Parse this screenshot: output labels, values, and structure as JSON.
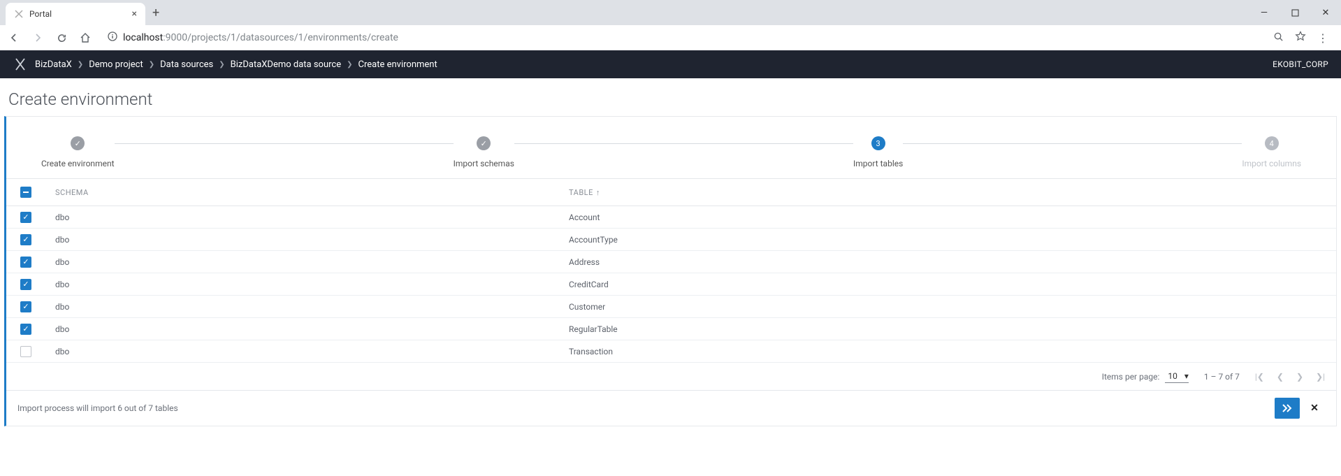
{
  "browser": {
    "tab_title": "Portal",
    "url_host": "localhost",
    "url_port_path": ":9000/projects/1/datasources/1/environments/create"
  },
  "header": {
    "brand": "BizDataX",
    "crumbs": [
      "Demo project",
      "Data sources",
      "BizDataXDemo data source",
      "Create environment"
    ],
    "user": "EKOBIT_CORP"
  },
  "page": {
    "title": "Create environment"
  },
  "stepper": {
    "steps": [
      {
        "label": "Create environment",
        "state": "done"
      },
      {
        "label": "Import schemas",
        "state": "done"
      },
      {
        "label": "Import tables",
        "state": "active",
        "num": "3"
      },
      {
        "label": "Import columns",
        "state": "next",
        "num": "4"
      }
    ]
  },
  "table": {
    "columns": {
      "schema": "SCHEMA",
      "table": "TABLE"
    },
    "rows": [
      {
        "schema": "dbo",
        "table": "Account",
        "checked": true
      },
      {
        "schema": "dbo",
        "table": "AccountType",
        "checked": true
      },
      {
        "schema": "dbo",
        "table": "Address",
        "checked": true
      },
      {
        "schema": "dbo",
        "table": "CreditCard",
        "checked": true
      },
      {
        "schema": "dbo",
        "table": "Customer",
        "checked": true
      },
      {
        "schema": "dbo",
        "table": "RegularTable",
        "checked": true
      },
      {
        "schema": "dbo",
        "table": "Transaction",
        "checked": false
      }
    ]
  },
  "paginator": {
    "items_per_page_label": "Items per page:",
    "items_per_page_value": "10",
    "range": "1 – 7 of 7"
  },
  "footer": {
    "summary": "Import process will import 6 out of 7 tables"
  }
}
